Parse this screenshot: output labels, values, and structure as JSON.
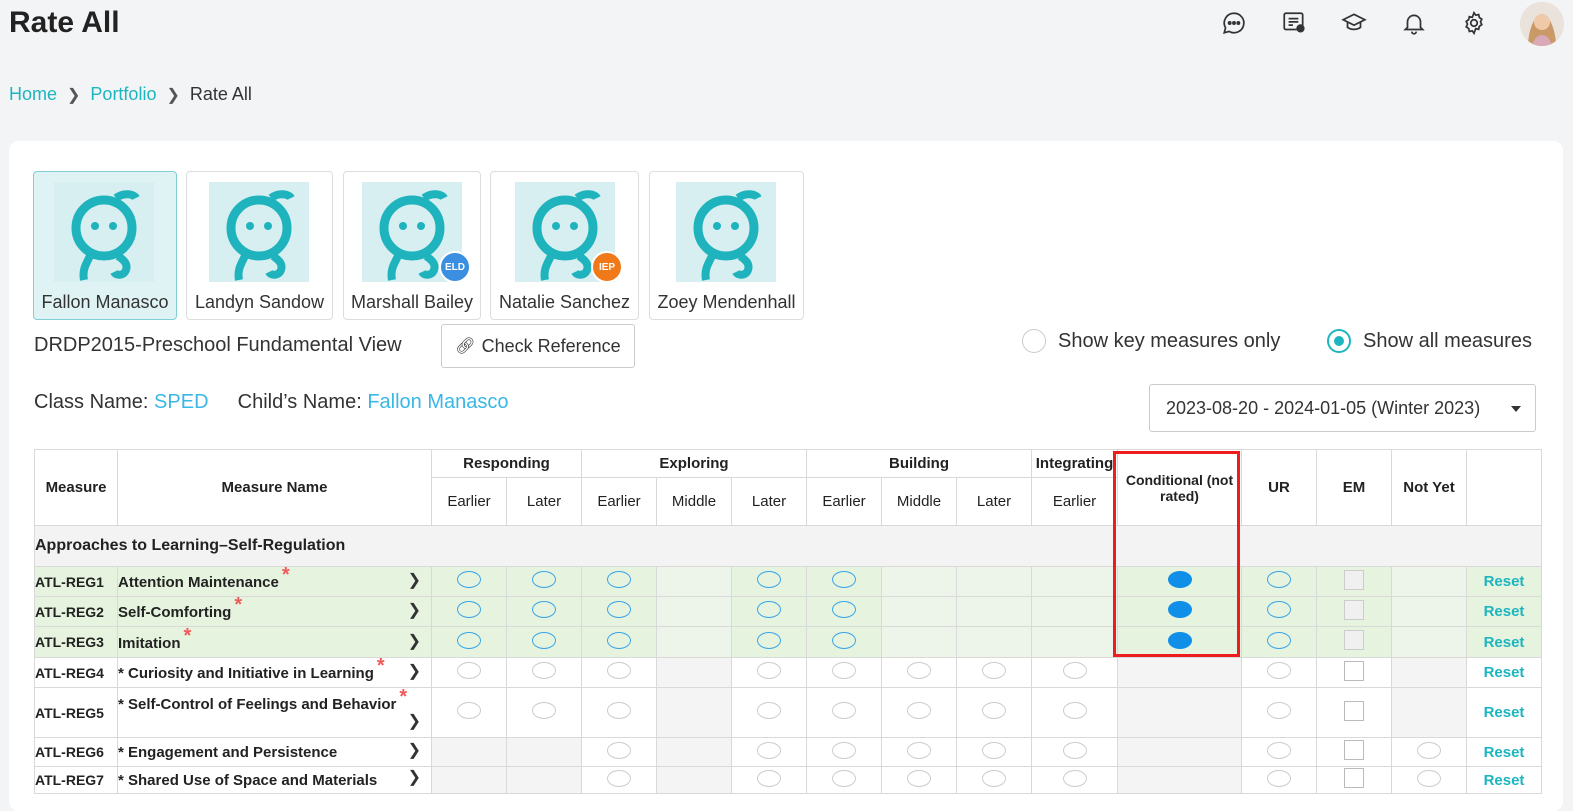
{
  "page_title": "Rate All",
  "breadcrumb": {
    "home": "Home",
    "portfolio": "Portfolio",
    "current": "Rate All"
  },
  "header_icons": [
    "chat-icon",
    "notes-icon",
    "graduation-cap-icon",
    "bell-icon",
    "gear-icon"
  ],
  "children": [
    {
      "name": "Fallon Manasco",
      "badge": ""
    },
    {
      "name": "Landyn Sandow",
      "badge": ""
    },
    {
      "name": "Marshall Bailey",
      "badge": "ELD",
      "badge_color": "#3b8fe0"
    },
    {
      "name": "Natalie Sanchez",
      "badge": "IEP",
      "badge_color": "#f07a1a"
    },
    {
      "name": "Zoey Mendenhall",
      "badge": ""
    }
  ],
  "view_name": "DRDP2015-Preschool Fundamental View",
  "check_reference": "Check Reference",
  "show_key_measures": "Show key measures only",
  "show_all_measures": "Show all measures",
  "class_name_label": "Class Name:",
  "class_name_value": "SPED",
  "child_name_label": "Child’s Name:",
  "child_name_value": "Fallon Manasco",
  "period": "2023-08-20 - 2024-01-05 (Winter 2023)",
  "table": {
    "col_measure": "Measure",
    "col_measure_name": "Measure Name",
    "groups": {
      "responding": "Responding",
      "exploring": "Exploring",
      "building": "Building",
      "integrating": "Integrating"
    },
    "sub": {
      "earlier": "Earlier",
      "later": "Later",
      "middle": "Middle"
    },
    "col_conditional": "Conditional (not rated)",
    "col_ur": "UR",
    "col_em": "EM",
    "col_not_yet": "Not Yet",
    "section_title": "Approaches to Learning–Self-Regulation",
    "reset_label": "Reset",
    "rows": [
      {
        "code": "ATL-REG1",
        "name": "Attention Maintenance"
      },
      {
        "code": "ATL-REG2",
        "name": "Self-Comforting"
      },
      {
        "code": "ATL-REG3",
        "name": "Imitation"
      },
      {
        "code": "ATL-REG4",
        "name": "* Curiosity and Initiative in Learning"
      },
      {
        "code": "ATL-REG5",
        "name": "* Self-Control of Feelings and Behavior"
      },
      {
        "code": "ATL-REG6",
        "name": "* Engagement and Persistence"
      },
      {
        "code": "ATL-REG7",
        "name": "* Shared Use of Space and Materials"
      }
    ]
  }
}
